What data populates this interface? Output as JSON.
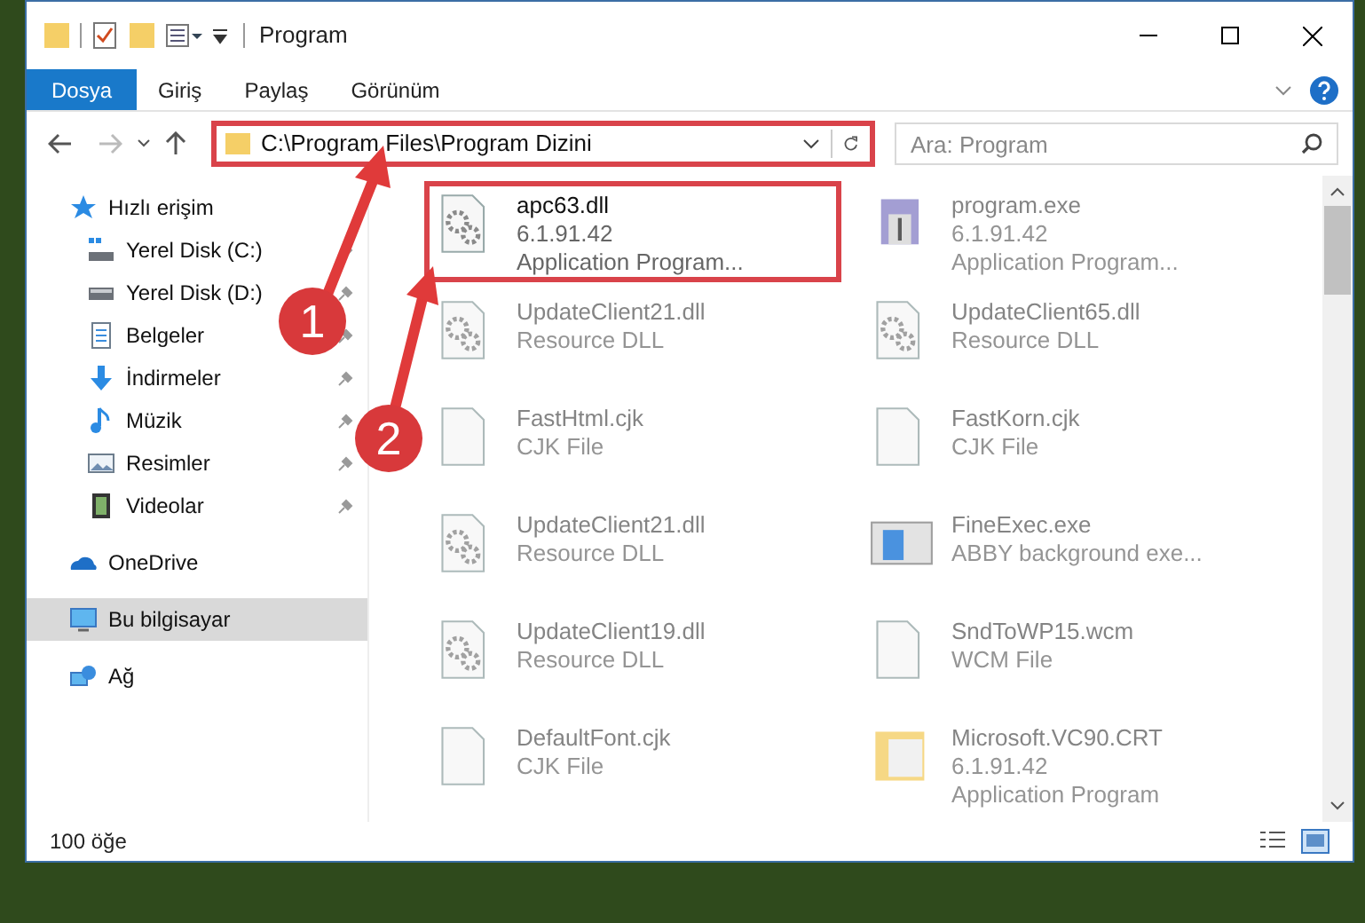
{
  "window": {
    "title": "Program"
  },
  "ribbon_tabs": [
    {
      "label": "Dosya",
      "selected": true
    },
    {
      "label": "Giriş",
      "selected": false
    },
    {
      "label": "Paylaş",
      "selected": false
    },
    {
      "label": "Görünüm",
      "selected": false
    }
  ],
  "address": {
    "value": "C:\\Program Files\\Program Dizini",
    "highlighted": true
  },
  "search": {
    "placeholder": "Ara: Program"
  },
  "sidebar": {
    "items": [
      {
        "label": "Hızlı erişim",
        "kind": "star",
        "pinned": false,
        "selected": false,
        "children": [
          {
            "label": "Yerel Disk (C:)",
            "kind": "disk-c",
            "pinned": true,
            "selected": false
          },
          {
            "label": "Yerel Disk (D:)",
            "kind": "disk",
            "pinned": true,
            "selected": false
          },
          {
            "label": "Belgeler",
            "kind": "docs",
            "pinned": true,
            "selected": false
          },
          {
            "label": "İndirmeler",
            "kind": "download",
            "pinned": true,
            "selected": false
          },
          {
            "label": "Müzik",
            "kind": "music",
            "pinned": true,
            "selected": false
          },
          {
            "label": "Resimler",
            "kind": "pictures",
            "pinned": true,
            "selected": false
          },
          {
            "label": "Videolar",
            "kind": "video",
            "pinned": true,
            "selected": false
          }
        ]
      },
      {
        "label": "OneDrive",
        "kind": "cloud",
        "pinned": false,
        "selected": false
      },
      {
        "label": "Bu bilgisayar",
        "kind": "pc",
        "pinned": false,
        "selected": true
      },
      {
        "label": "Ağ",
        "kind": "network",
        "pinned": false,
        "selected": false
      }
    ]
  },
  "files": [
    {
      "name": "apc63.dll",
      "lines": [
        "6.1.91.42",
        "Application Program..."
      ],
      "kind": "dll",
      "highlighted": true,
      "dimmed": false
    },
    {
      "name": "program.exe",
      "lines": [
        "6.1.91.42",
        "Application Program..."
      ],
      "kind": "exe",
      "highlighted": false,
      "dimmed": true
    },
    {
      "name": "UpdateClient21.dll",
      "lines": [
        "Resource DLL"
      ],
      "kind": "dll",
      "highlighted": false,
      "dimmed": true
    },
    {
      "name": "UpdateClient65.dll",
      "lines": [
        "Resource DLL"
      ],
      "kind": "dll",
      "highlighted": false,
      "dimmed": true
    },
    {
      "name": "FastHtml.cjk",
      "lines": [
        "CJK File"
      ],
      "kind": "blank",
      "highlighted": false,
      "dimmed": true
    },
    {
      "name": "FastKorn.cjk",
      "lines": [
        "CJK File"
      ],
      "kind": "blank",
      "highlighted": false,
      "dimmed": true
    },
    {
      "name": "UpdateClient21.dll",
      "lines": [
        "Resource DLL"
      ],
      "kind": "dll",
      "highlighted": false,
      "dimmed": true
    },
    {
      "name": "FineExec.exe",
      "lines": [
        "ABBY background exe..."
      ],
      "kind": "app",
      "highlighted": false,
      "dimmed": true
    },
    {
      "name": "UpdateClient19.dll",
      "lines": [
        "Resource DLL"
      ],
      "kind": "dll",
      "highlighted": false,
      "dimmed": true
    },
    {
      "name": "SndToWP15.wcm",
      "lines": [
        "WCM File"
      ],
      "kind": "blank",
      "highlighted": false,
      "dimmed": true
    },
    {
      "name": "DefaultFont.cjk",
      "lines": [
        "CJK File"
      ],
      "kind": "blank",
      "highlighted": false,
      "dimmed": true
    },
    {
      "name": "Microsoft.VC90.CRT",
      "lines": [
        "6.1.91.42",
        "Application Program"
      ],
      "kind": "folder",
      "highlighted": false,
      "dimmed": true
    }
  ],
  "status_bar": {
    "count": "100 öğe"
  },
  "callouts": [
    {
      "number": "1"
    },
    {
      "number": "2"
    }
  ]
}
